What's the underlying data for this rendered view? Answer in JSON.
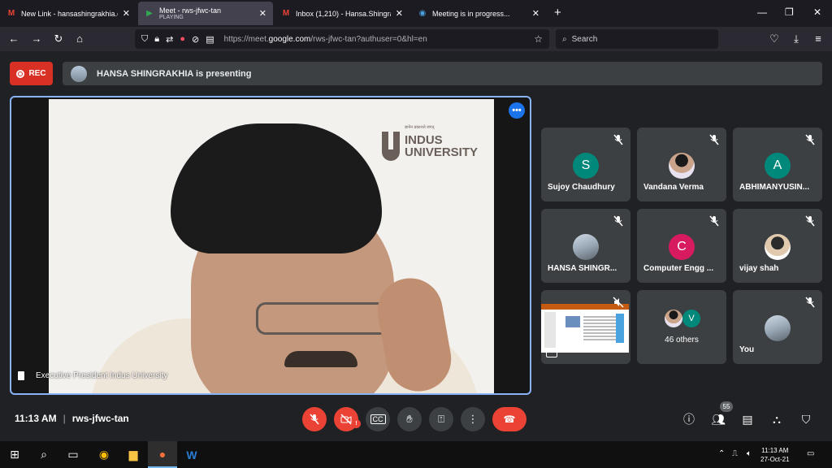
{
  "browser": {
    "tabs": [
      {
        "title": "New Link - hansashingrakhia.co",
        "subtitle": "",
        "favicon": "gmail-icon",
        "active": false
      },
      {
        "title": "Meet - rws-jfwc-tan",
        "subtitle": "PLAYING",
        "favicon": "meet-icon",
        "active": true
      },
      {
        "title": "Inbox (1,210) - Hansa.Shingrakh",
        "subtitle": "",
        "favicon": "gmail-icon",
        "active": false
      },
      {
        "title": "Meeting is in progress...",
        "subtitle": "",
        "favicon": "meeting-icon",
        "active": false
      }
    ],
    "url_prefix": "https://meet.",
    "url_domain": "google.com",
    "url_suffix": "/rws-jfwc-tan?authuser=0&hl=en",
    "search_placeholder": "Search"
  },
  "meet": {
    "rec_label": "REC",
    "presenting_text": "HANSA SHINGRAKHIA is presenting",
    "main_caption": "Executive President Indus University",
    "logo_line1": "INDUS",
    "logo_line2": "UNIVERSITY",
    "logo_tagline": "ज्ञानेन प्रकाशते जगत्",
    "participants": [
      {
        "name": "Sujoy Chaudhury",
        "initial": "S",
        "avatar_color": "#00897b"
      },
      {
        "name": "Vandana Verma",
        "initial": "",
        "avatar_color": ""
      },
      {
        "name": "ABHIMANYUSIN...",
        "initial": "A",
        "avatar_color": "#00897b"
      },
      {
        "name": "HANSA SHINGR...",
        "initial": "",
        "avatar_color": ""
      },
      {
        "name": "Computer Engg ...",
        "initial": "C",
        "avatar_color": "#d81b60"
      },
      {
        "name": "vijay shah",
        "initial": "",
        "avatar_color": ""
      }
    ],
    "others_label": "46 others",
    "others_initial": "V",
    "you_label": "You",
    "time": "11:13 AM",
    "meeting_code": "rws-jfwc-tan",
    "people_count": "55",
    "accent_color": "#8ab4f8",
    "danger_color": "#ea4335"
  },
  "taskbar": {
    "time": "11:13 AM",
    "date": "27-Oct-21"
  }
}
